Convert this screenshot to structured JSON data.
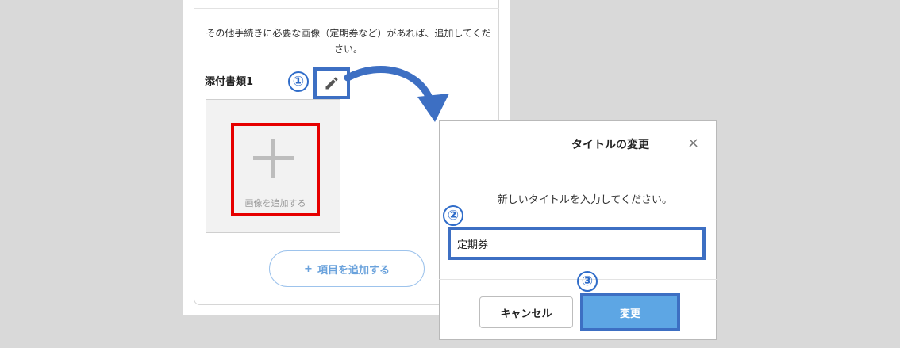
{
  "card": {
    "instruction": "その他手続きに必要な画像（定期券など）があれば、追加してください。",
    "attachment_title": "添付書類1",
    "add_image_label": "画像を追加する",
    "add_item_label": "項目を追加する",
    "add_item_icon": "+"
  },
  "steps": {
    "one": "①",
    "two": "②",
    "three": "③"
  },
  "dialog": {
    "title": "タイトルの変更",
    "close_icon": "×",
    "message": "新しいタイトルを入力してください。",
    "input_value": "定期券",
    "cancel_label": "キャンセル",
    "change_label": "変更"
  },
  "colors": {
    "highlight_blue": "#3d6fc3",
    "highlight_red": "#e60000",
    "primary_button": "#5da6e4",
    "outline_button": "#9dc3ec"
  }
}
